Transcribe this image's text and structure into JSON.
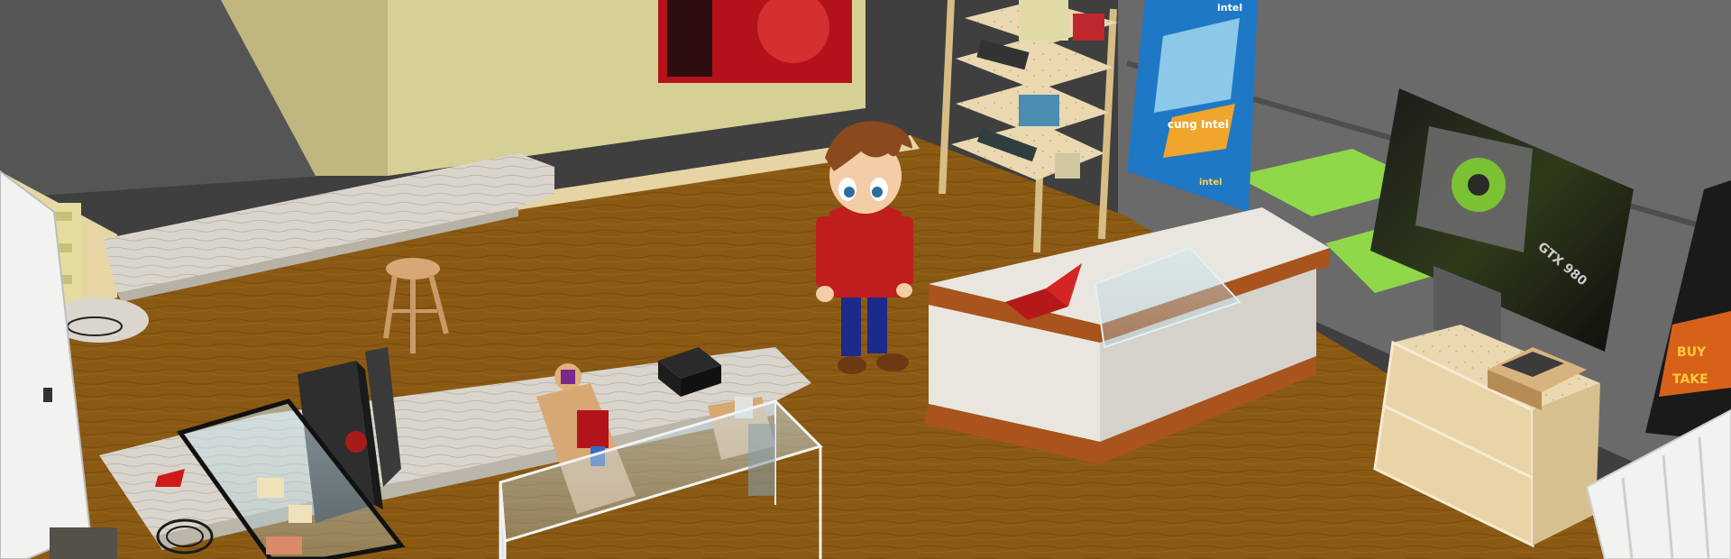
{
  "scene": {
    "kind": "3D computer shop interior",
    "colors": {
      "floor": "#8a5a14",
      "floor_dark": "#6b430b",
      "back_wall": "#5c5c5c",
      "cream_wall": "#d8d29a",
      "counter_white": "#e9e6e0",
      "counter_trim": "#a8541c",
      "player_shirt": "#c01d1d",
      "player_pants": "#1c2a8a",
      "player_hair": "#8a4a1e"
    }
  },
  "posters": {
    "intel_banner": {
      "brand": "intel",
      "headline": "cung Intel",
      "badge": "intel"
    },
    "gpu_poster": {
      "model": "GTX 980"
    },
    "amd_poster": {
      "line1": "BUY",
      "line2": "TAKE"
    }
  },
  "props": [
    "shelf-unit",
    "glass-display-case",
    "white-sales-counter",
    "red-laptop",
    "bar-stool",
    "pc-tower",
    "desk-monitor",
    "external-drive",
    "display-stand",
    "wooden-side-table",
    "keyboard-box"
  ]
}
